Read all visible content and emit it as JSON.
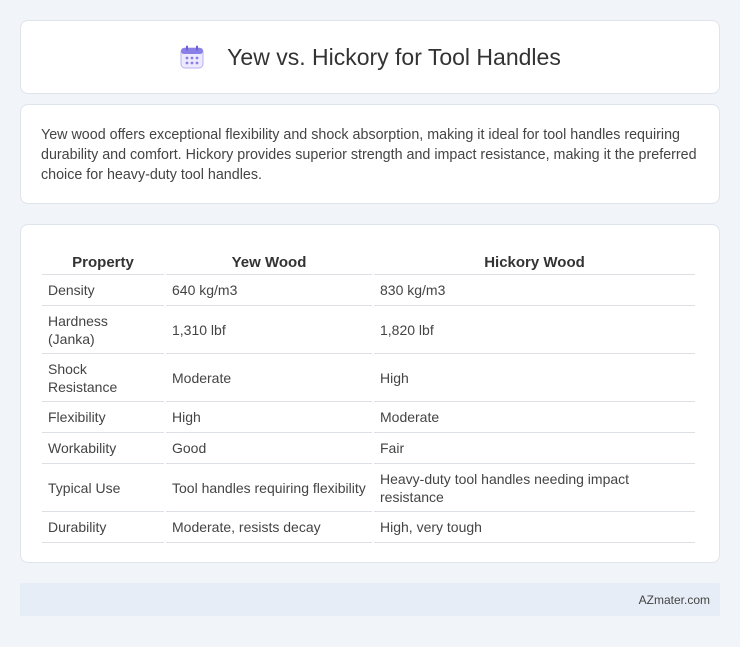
{
  "header": {
    "title": "Yew vs. Hickory for Tool Handles",
    "icon": "calendar-icon"
  },
  "intro": {
    "text": "Yew wood offers exceptional flexibility and shock absorption, making it ideal for tool handles requiring durability and comfort. Hickory provides superior strength and impact resistance, making it the preferred choice for heavy-duty tool handles."
  },
  "table": {
    "headers": [
      "Property",
      "Yew Wood",
      "Hickory Wood"
    ],
    "rows": [
      [
        "Density",
        "640 kg/m3",
        "830 kg/m3"
      ],
      [
        "Hardness (Janka)",
        "1,310 lbf",
        "1,820 lbf"
      ],
      [
        "Shock Resistance",
        "Moderate",
        "High"
      ],
      [
        "Flexibility",
        "High",
        "Moderate"
      ],
      [
        "Workability",
        "Good",
        "Fair"
      ],
      [
        "Typical Use",
        "Tool handles requiring flexibility",
        "Heavy-duty tool handles needing impact resistance"
      ],
      [
        "Durability",
        "Moderate, resists decay",
        "High, very tough"
      ]
    ]
  },
  "footer": {
    "text": "AZmater.com"
  },
  "colors": {
    "background": "#f1f4f9",
    "footer_bg": "#e6edf6",
    "icon_accent": "#7b6cd9"
  }
}
